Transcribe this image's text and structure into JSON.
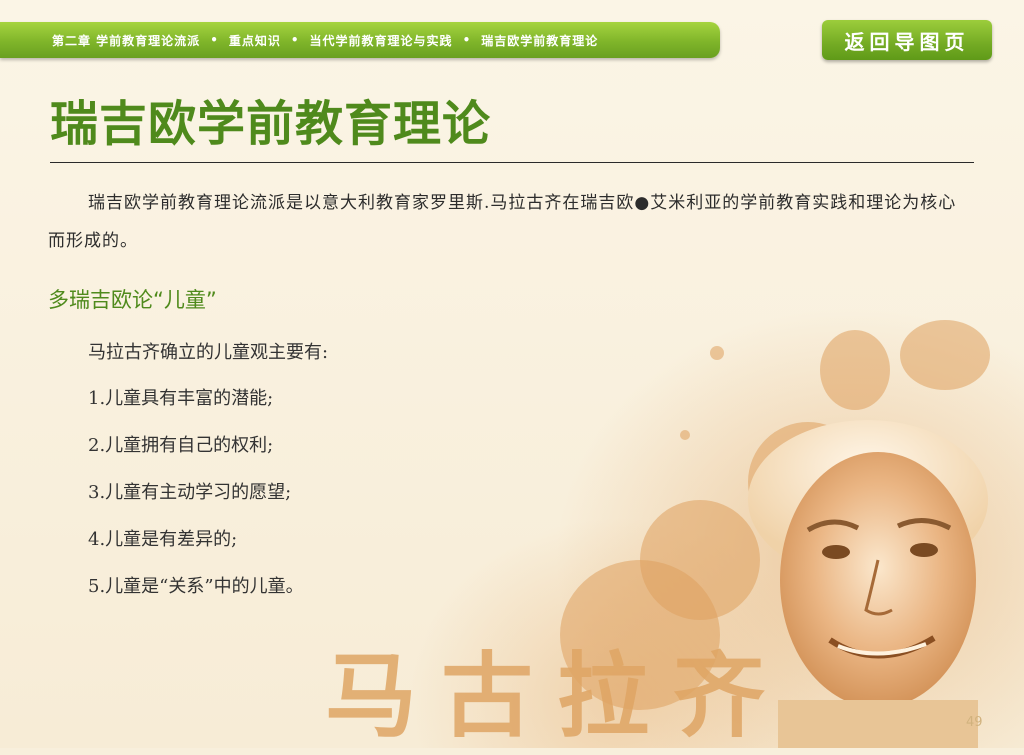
{
  "breadcrumb": {
    "items": [
      "第二章 学前教育理论流派",
      "重点知识",
      "当代学前教育理论与实践",
      "瑞吉欧学前教育理论"
    ],
    "separator": "•"
  },
  "back_button": {
    "label": "返回导图页"
  },
  "page": {
    "title": "瑞吉欧学前教育理论",
    "intro": "瑞吉欧学前教育理论流派是以意大利教育家罗里斯.马拉古齐在瑞吉欧●艾米利亚的学前教育实践和理论为核心而形成的。",
    "section_heading": "多瑞吉欧论“儿童”",
    "lead": "马拉古齐确立的儿童观主要有:",
    "views": [
      "1.儿童具有丰富的潜能;",
      "2.儿童拥有自己的权利;",
      "3.儿童有主动学习的愿望;",
      "4.儿童是有差异的;",
      "5.儿童是“关系”中的儿童。"
    ],
    "name_art": "马古拉齐",
    "page_number": "49"
  },
  "colors": {
    "accent_green": "#4f8a1c",
    "bar_green": "#7fb52a",
    "background": "#f8efdc",
    "sepia": "#d9a468"
  }
}
